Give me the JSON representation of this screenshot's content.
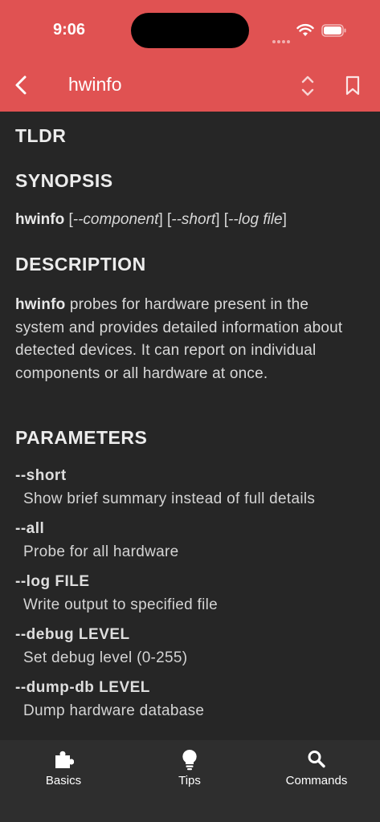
{
  "status_bar": {
    "time": "9:06"
  },
  "nav": {
    "title": "hwinfo"
  },
  "sections": {
    "tldr": "TLDR",
    "synopsis": "SYNOPSIS",
    "description": "DESCRIPTION",
    "parameters": "PARAMETERS"
  },
  "synopsis": {
    "command": "hwinfo",
    "open1": " [",
    "opt1": "--component",
    "close1": "] [",
    "opt2": "--short",
    "close2": "] [",
    "opt3": "--log file",
    "close3": "]"
  },
  "description": {
    "command": "hwinfo",
    "text": " probes for hardware present in the system and provides detailed information about detected devices. It can report on individual components or all hardware at once."
  },
  "parameters": [
    {
      "name": "--short",
      "desc": "Show brief summary instead of full details"
    },
    {
      "name": "--all",
      "desc": "Probe for all hardware"
    },
    {
      "name": "--log FILE",
      "desc": "Write output to specified file"
    },
    {
      "name": "--debug LEVEL",
      "desc": "Set debug level (0-255)"
    },
    {
      "name": "--dump-db LEVEL",
      "desc": "Dump hardware database"
    }
  ],
  "tabs": [
    {
      "label": "Basics",
      "icon": "puzzle-icon"
    },
    {
      "label": "Tips",
      "icon": "lightbulb-icon"
    },
    {
      "label": "Commands",
      "icon": "search-icon"
    }
  ],
  "colors": {
    "header": "#e05252",
    "background": "#262626",
    "tabbar": "#2e2e2e"
  }
}
